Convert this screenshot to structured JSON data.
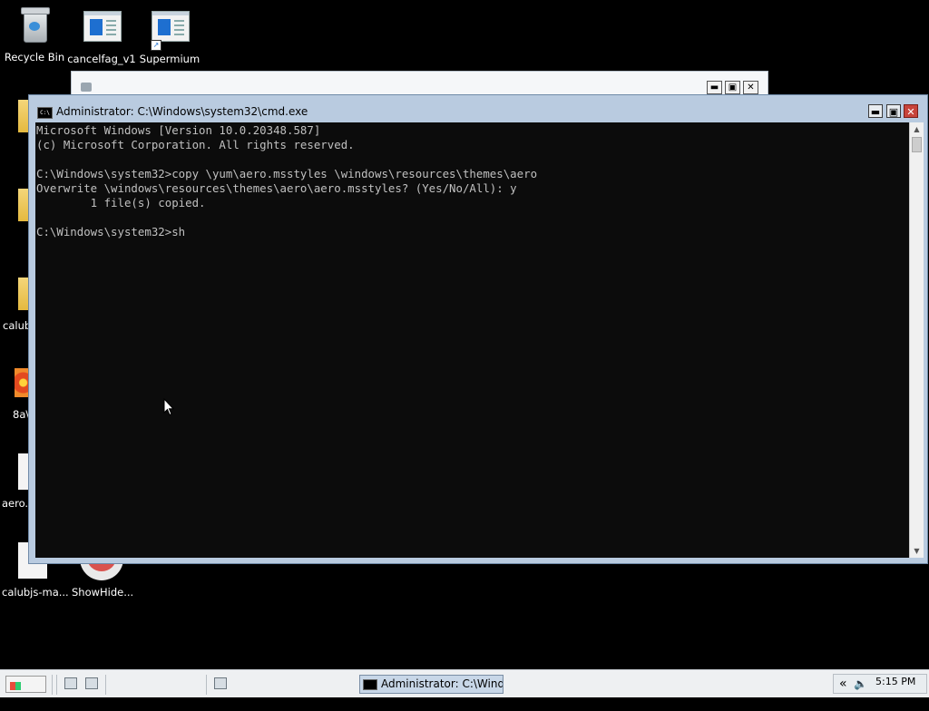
{
  "desktop": {
    "icons": [
      {
        "label": "Recycle Bin"
      },
      {
        "label": "cancelfag_v1"
      },
      {
        "label": "Supermium"
      }
    ],
    "left_partial_labels": [
      "calub",
      "8a\\",
      "aero.r",
      "calubjs-ma...",
      "ShowHide..."
    ]
  },
  "back_window": {
    "minimize": "▬",
    "maximize": "▣",
    "close": "✕"
  },
  "cmd_window": {
    "title": "Administrator: C:\\Windows\\system32\\cmd.exe",
    "icon_text": "C:\\",
    "minimize": "▬",
    "maximize": "▣",
    "close": "✕",
    "lines": [
      "Microsoft Windows [Version 10.0.20348.587]",
      "(c) Microsoft Corporation. All rights reserved.",
      "",
      "C:\\Windows\\system32>copy \\yum\\aero.msstyles \\windows\\resources\\themes\\aero",
      "Overwrite \\windows\\resources\\themes\\aero\\aero.msstyles? (Yes/No/All): y",
      "        1 file(s) copied.",
      "",
      "C:\\Windows\\system32>sh"
    ],
    "scroll_up": "▲",
    "scroll_down": "▼"
  },
  "taskbar": {
    "start_label": "Start",
    "active_task": "Administrator: C:\\Wind...",
    "tray_chevron": "«",
    "volume_icon": "🔈",
    "clock": "5:15 PM"
  }
}
